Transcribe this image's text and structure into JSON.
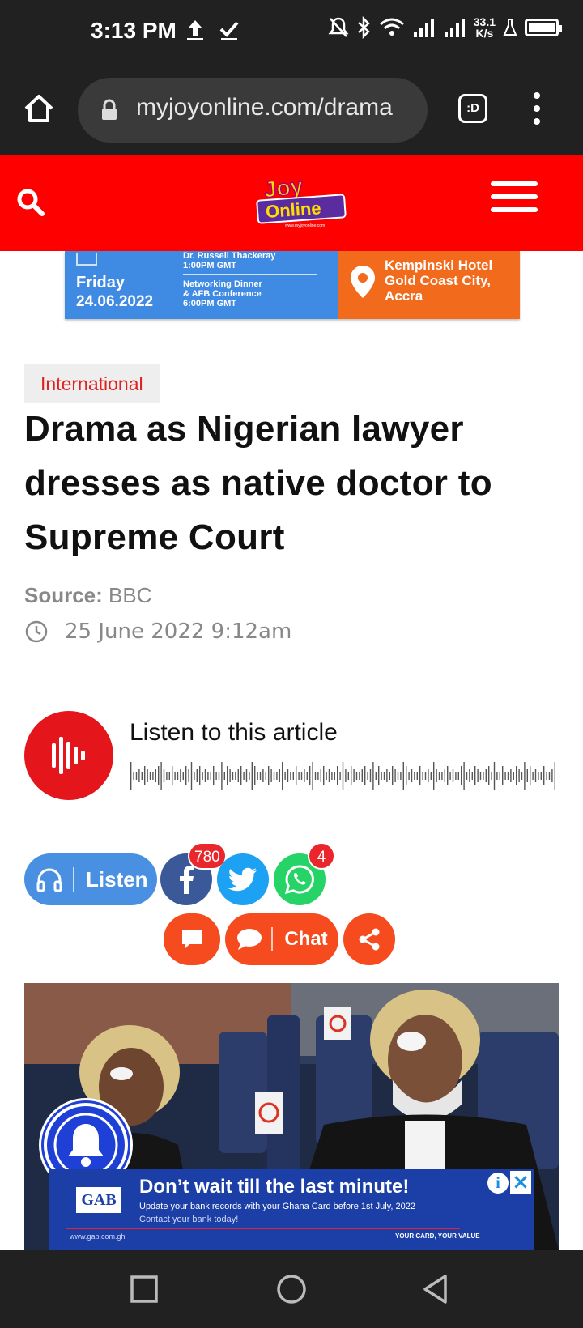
{
  "status_bar": {
    "time": "3:13 PM",
    "net_speed_value": "33.1",
    "net_speed_unit": "K/s",
    "battery_level": 1.0,
    "icons": [
      "upload-icon",
      "check-icon",
      "bell-off-icon",
      "bluetooth-icon",
      "wifi-icon",
      "signal-icon",
      "signal-icon",
      "lab-icon",
      "battery-icon"
    ]
  },
  "browser": {
    "url": "myjoyonline.com/drama",
    "tabs_label": ":D"
  },
  "site_header": {
    "logo_text": "Joy Online",
    "logo_small": "www.myjoyonline.com"
  },
  "banner_ad": {
    "day": "Friday",
    "date": "24.06.2022",
    "event1_name": "Dr. Russell Thackeray",
    "event1_time": "1:00PM GMT",
    "event2_line1": "Networking Dinner",
    "event2_line2": "& AFB Conference",
    "event2_time": "6:00PM GMT",
    "venue_line1": "Kempinski Hotel",
    "venue_line2": "Gold Coast City,",
    "venue_line3": "Accra"
  },
  "article": {
    "category": "International",
    "headline": "Drama as Nigerian lawyer dresses as native doctor to Supreme Court",
    "source_label": "Source:",
    "source_value": "BBC",
    "date": "25 June 2022 9:12am"
  },
  "player": {
    "title": "Listen to this article"
  },
  "share": {
    "listen_label": "Listen",
    "facebook_count": "780",
    "whatsapp_count": "4",
    "chat_label": "Chat"
  },
  "bottom_ad": {
    "logo": "GAB",
    "headline": "Don’t wait till the last minute!",
    "line1": "Update your bank records with your Ghana Card before 1st July, 2022",
    "line2": "Contact your bank today!",
    "url": "www.gab.com.gh",
    "tagline": "YOUR CARD, YOUR VALUE"
  },
  "colors": {
    "brand_red": "#ff0000",
    "accent_orange": "#f54b1f",
    "facebook": "#3b5998",
    "twitter": "#1da1f2",
    "whatsapp": "#25d366",
    "listen_blue": "#4a90e2"
  }
}
